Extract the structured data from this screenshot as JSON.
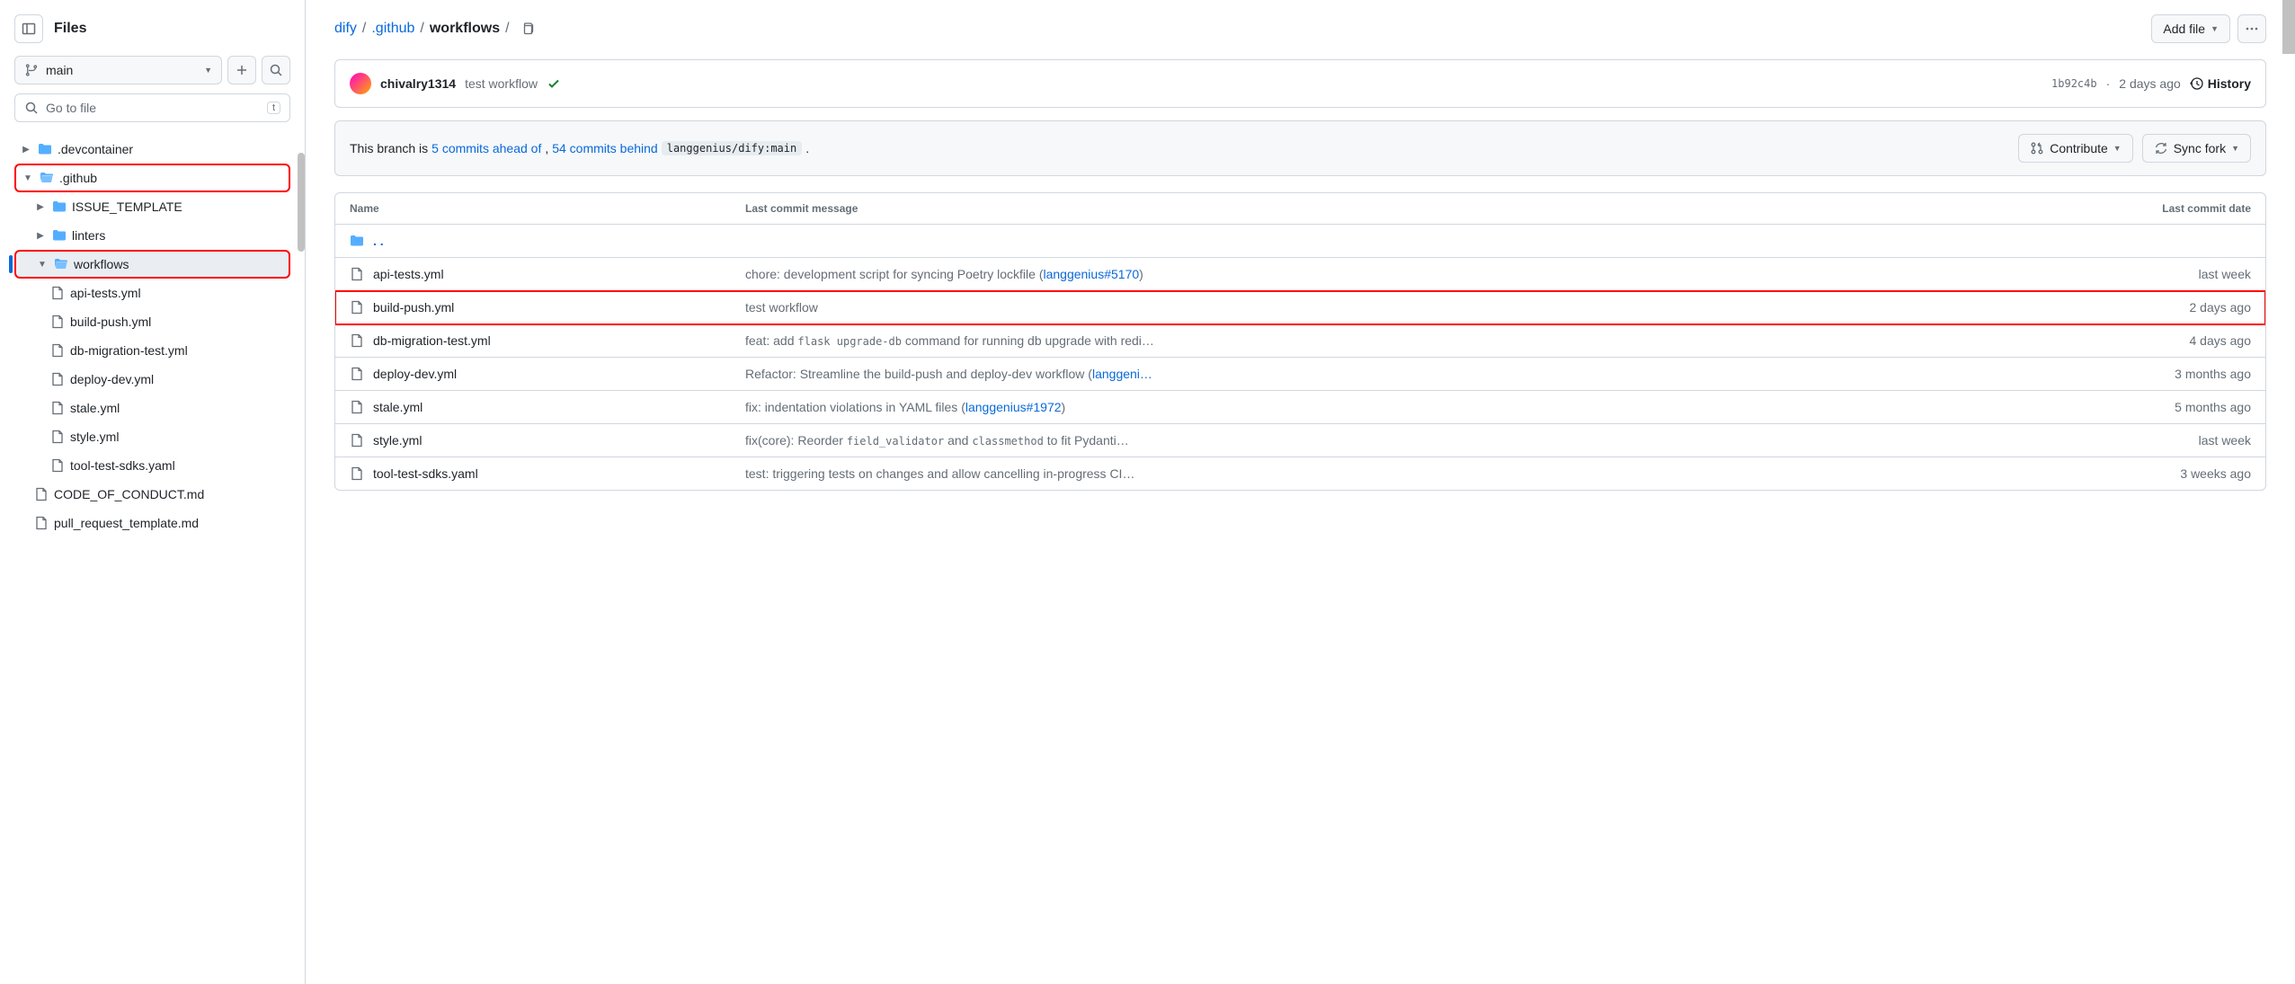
{
  "sidebar": {
    "title": "Files",
    "branch": "main",
    "goto_placeholder": "Go to file",
    "goto_key": "t",
    "tree": {
      "devcontainer": ".devcontainer",
      "github": ".github",
      "issue_template": "ISSUE_TEMPLATE",
      "linters": "linters",
      "workflows": "workflows",
      "api_tests": "api-tests.yml",
      "build_push": "build-push.yml",
      "db_migration": "db-migration-test.yml",
      "deploy_dev": "deploy-dev.yml",
      "stale": "stale.yml",
      "style": "style.yml",
      "tool_test": "tool-test-sdks.yaml",
      "code_conduct": "CODE_OF_CONDUCT.md",
      "pr_template": "pull_request_template.md"
    }
  },
  "header": {
    "crumb1": "dify",
    "crumb2": ".github",
    "crumb3": "workflows",
    "add_file": "Add file"
  },
  "commit": {
    "author": "chivalry1314",
    "message": "test workflow",
    "sha": "1b92c4b",
    "date": "2 days ago",
    "history": "History"
  },
  "compare": {
    "prefix": "This branch is",
    "ahead": "5 commits ahead of",
    "behind": "54 commits behind",
    "target": "langgenius/dify:main",
    "contribute": "Contribute",
    "sync": "Sync fork"
  },
  "table": {
    "col_name": "Name",
    "col_msg": "Last commit message",
    "col_date": "Last commit date",
    "rows": [
      {
        "name": "api-tests.yml",
        "msg_pre": "chore: development script for syncing Poetry lockfile (",
        "msg_link": "langgenius#5170",
        "msg_post": ")",
        "date": "last week"
      },
      {
        "name": "build-push.yml",
        "msg_pre": "test workflow",
        "msg_link": "",
        "msg_post": "",
        "date": "2 days ago",
        "highlight": true
      },
      {
        "name": "db-migration-test.yml",
        "msg_pre": "feat: add ",
        "msg_mono": "flask upgrade-db",
        "msg_post": " command for running db upgrade with redi…",
        "date": "4 days ago"
      },
      {
        "name": "deploy-dev.yml",
        "msg_pre": "Refactor: Streamline the build-push and deploy-dev workflow (",
        "msg_link": "langgeni…",
        "msg_post": "",
        "date": "3 months ago"
      },
      {
        "name": "stale.yml",
        "msg_pre": "fix: indentation violations in YAML files (",
        "msg_link": "langgenius#1972",
        "msg_post": ")",
        "date": "5 months ago"
      },
      {
        "name": "style.yml",
        "msg_pre": "fix(core): Reorder ",
        "msg_mono": "field_validator",
        "msg_mid": " and ",
        "msg_mono2": "classmethod",
        "msg_post": " to fit Pydanti…",
        "date": "last week"
      },
      {
        "name": "tool-test-sdks.yaml",
        "msg_pre": "test: triggering tests on changes and allow cancelling in-progress CI…",
        "date": "3 weeks ago"
      }
    ]
  }
}
